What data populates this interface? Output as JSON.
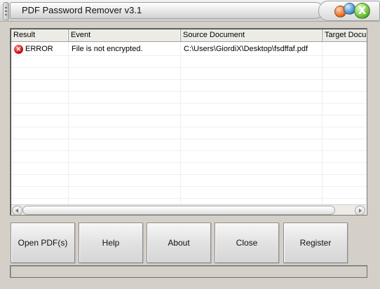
{
  "window": {
    "title": "PDF Password Remover v3.1",
    "close_glyph": "X"
  },
  "list": {
    "columns": [
      "Result",
      "Event",
      "Source Document",
      "Target Document"
    ],
    "rows": [
      {
        "result": "ERROR",
        "result_icon": "error-icon",
        "event": "File is not encrypted.",
        "source": "C:\\Users\\GiordiX\\Desktop\\fsdffaf.pdf",
        "target": ""
      }
    ]
  },
  "buttons": {
    "open": "Open PDF(s)",
    "help": "Help",
    "about": "About",
    "close": "Close",
    "register": "Register"
  },
  "status": {
    "text": ""
  },
  "colors": {
    "error": "#d0121b",
    "window_bg": "#d4d0c8",
    "close_green": "#6cc23a"
  }
}
